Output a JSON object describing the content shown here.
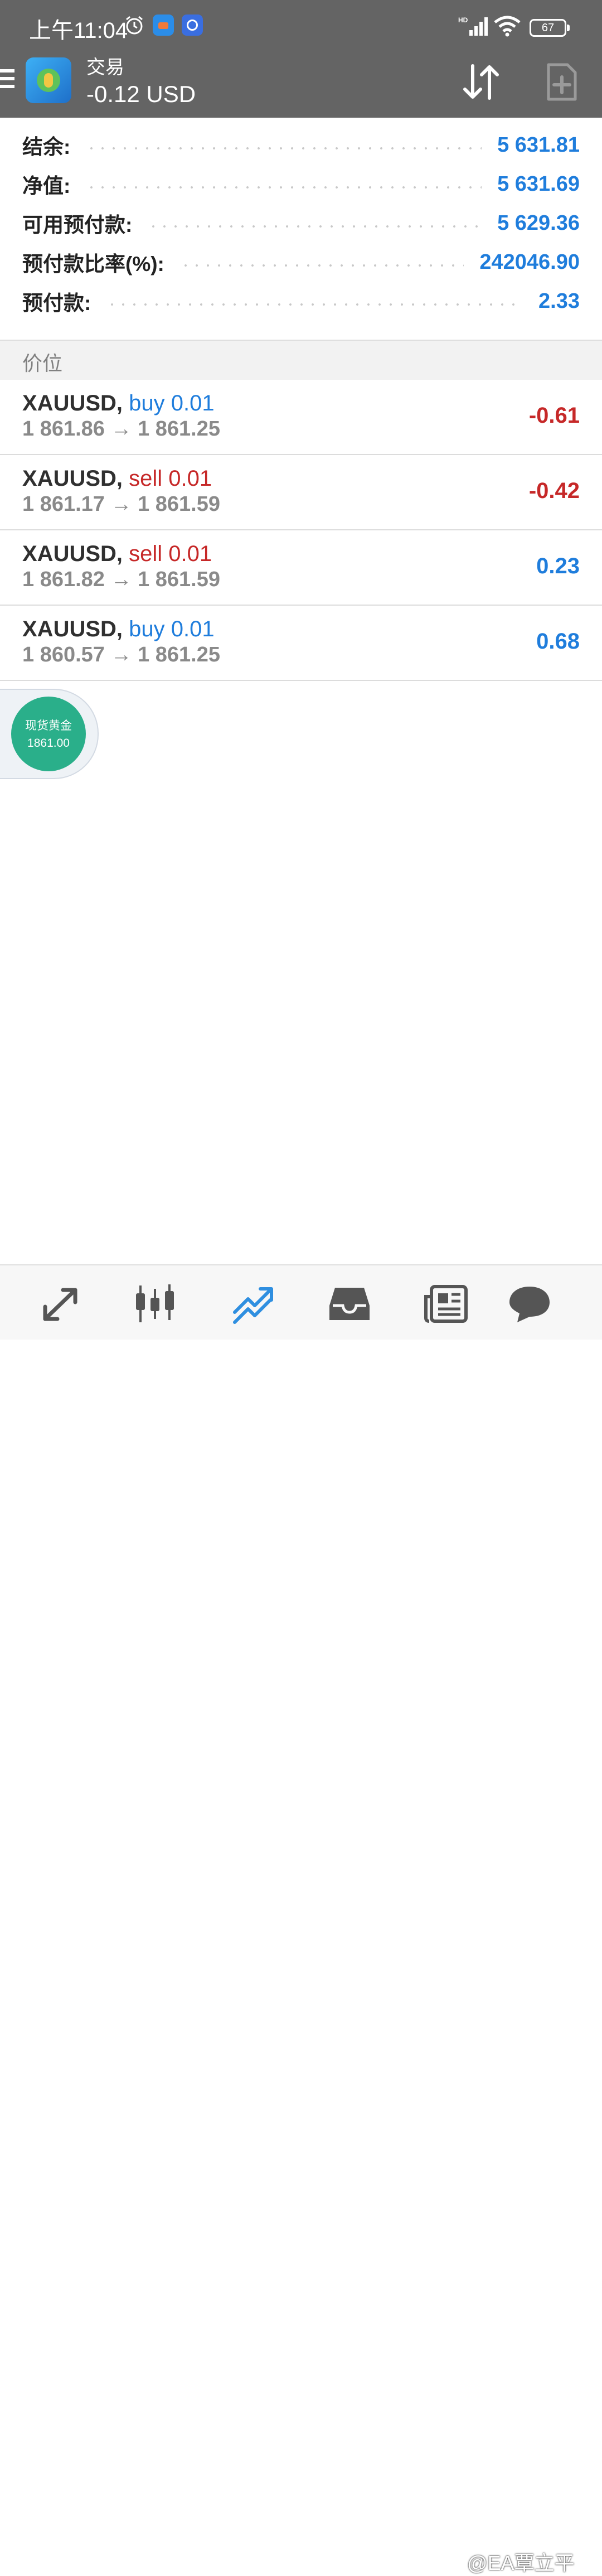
{
  "status_bar": {
    "time": "上午11:04",
    "battery": "67"
  },
  "header": {
    "title": "交易",
    "balance": "-0.12 USD"
  },
  "summary": [
    {
      "label": "结余:",
      "value": "5 631.81"
    },
    {
      "label": "净值:",
      "value": "5 631.69"
    },
    {
      "label": "可用预付款:",
      "value": "5 629.36"
    },
    {
      "label": "预付款比率(%):",
      "value": "242046.90"
    },
    {
      "label": "预付款:",
      "value": "2.33"
    }
  ],
  "section_title": "价位",
  "positions": [
    {
      "symbol": "XAUUSD",
      "side": "buy 0.01",
      "open": "1 861.86",
      "arrow": "→",
      "current": "1 861.25",
      "profit": "-0.61"
    },
    {
      "symbol": "XAUUSD",
      "side": "sell 0.01",
      "open": "1 861.17",
      "arrow": "→",
      "current": "1 861.59",
      "profit": "-0.42"
    },
    {
      "symbol": "XAUUSD",
      "side": "sell 0.01",
      "open": "1 861.82",
      "arrow": "→",
      "current": "1 861.59",
      "profit": "0.23"
    },
    {
      "symbol": "XAUUSD",
      "side": "buy 0.01",
      "open": "1 860.57",
      "arrow": "→",
      "current": "1 861.25",
      "profit": "0.68"
    }
  ],
  "floating_widget": {
    "name": "现货黄金",
    "price": "1861.00"
  },
  "watermark": "@EA覃立平",
  "colors": {
    "accent_blue": "#1f7ddc",
    "loss_red": "#c62828",
    "header_gray": "#646464",
    "widget_green": "#2aaf8a"
  },
  "bottom_nav": {
    "items": [
      {
        "icon": "quotes-arrows-icon"
      },
      {
        "icon": "candlestick-chart-icon"
      },
      {
        "icon": "trade-trend-icon",
        "active": true
      },
      {
        "icon": "history-inbox-icon"
      },
      {
        "icon": "news-icon"
      },
      {
        "icon": "chat-bubble-icon"
      }
    ]
  }
}
